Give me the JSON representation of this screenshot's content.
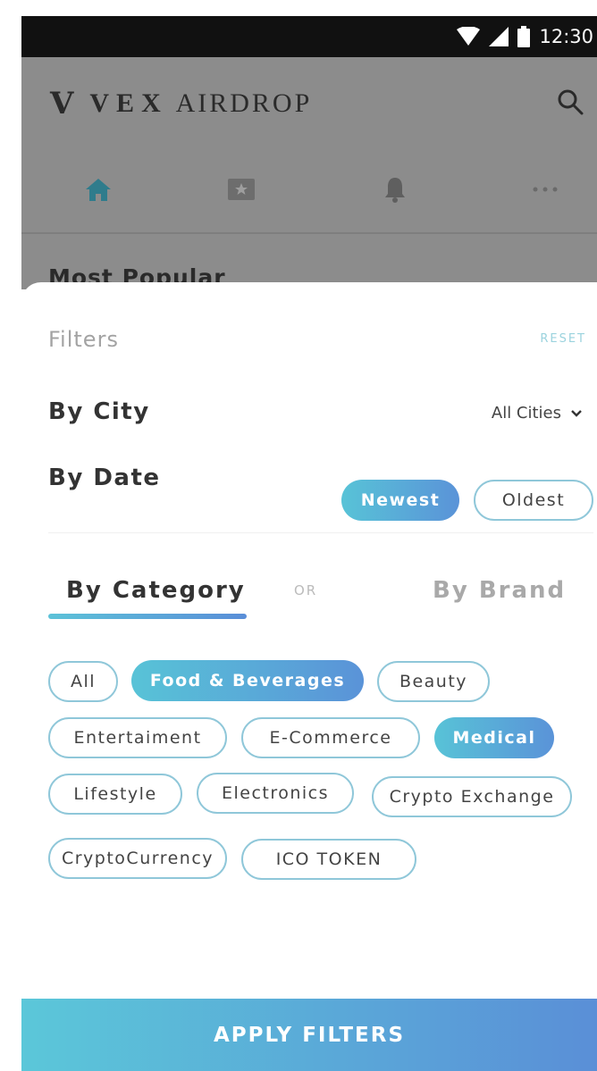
{
  "status_bar": {
    "time": "12:30"
  },
  "app": {
    "logo_mark": "V",
    "logo_bold": "VEX",
    "logo_rest": "AIRDROP",
    "section_peek": "Most Popular"
  },
  "tabs": [
    {
      "icon": "home-icon"
    },
    {
      "icon": "ticket-icon"
    },
    {
      "icon": "bell-icon"
    },
    {
      "icon": "more-icon"
    }
  ],
  "filters": {
    "title": "Filters",
    "reset_label": "RESET",
    "city": {
      "label": "By City",
      "selected": "All Cities"
    },
    "date": {
      "label": "By Date",
      "options": [
        "Newest",
        "Oldest"
      ],
      "selected": "Newest"
    },
    "segment": {
      "category": "By Category",
      "or": "OR",
      "brand": "By Brand",
      "active": "By Category"
    },
    "categories": [
      {
        "label": "All",
        "active": false
      },
      {
        "label": "Food & Beverages",
        "active": true
      },
      {
        "label": "Beauty",
        "active": false
      },
      {
        "label": "Entertaiment",
        "active": false
      },
      {
        "label": "E-Commerce",
        "active": false
      },
      {
        "label": "Medical",
        "active": true
      },
      {
        "label": "Lifestyle",
        "active": false
      },
      {
        "label": "Electronics",
        "active": false
      },
      {
        "label": "Crypto Exchange",
        "active": false
      },
      {
        "label": "CryptoCurrency",
        "active": false
      },
      {
        "label": "ICO TOKEN",
        "active": false
      }
    ],
    "apply_label": "APPLY FILTERS"
  },
  "colors": {
    "accent_start": "#58c3d7",
    "accent_end": "#5a93d8",
    "outline": "#8fc7d9",
    "overlay": "#8c8c8c"
  }
}
